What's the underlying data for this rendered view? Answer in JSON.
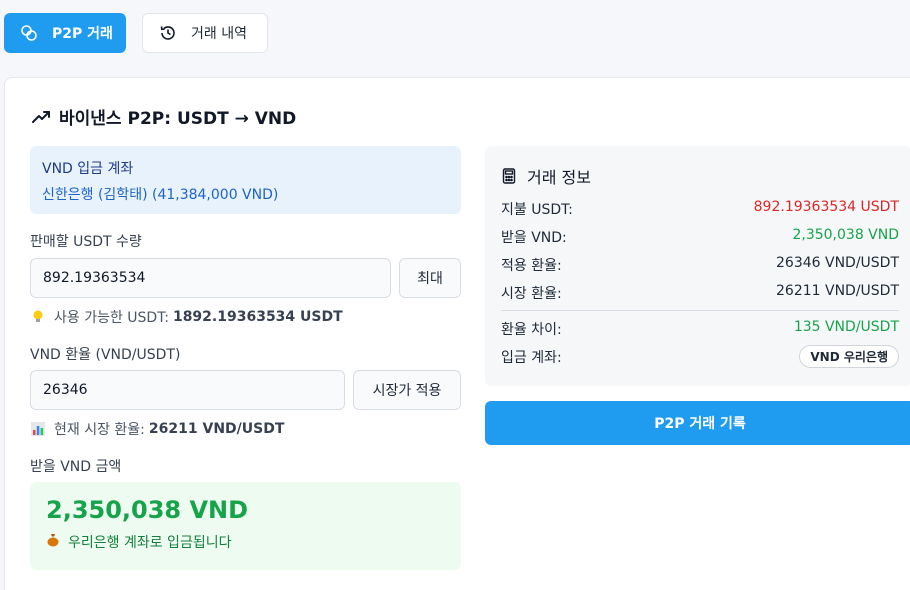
{
  "tabs": {
    "p2p_label": "P2P 거래",
    "history_label": "거래 내역"
  },
  "form": {
    "title": "바이낸스 P2P: USDT → VND",
    "deposit": {
      "label": "VND 입금 계좌",
      "value": "신한은행 (김학태) (41,384,000 VND)"
    },
    "usdt_amount": {
      "label": "판매할 USDT 수량",
      "value": "892.19363534",
      "max_button": "최대",
      "hint_prefix": "사용 가능한 USDT:",
      "hint_value": "1892.19363534 USDT"
    },
    "rate": {
      "label": "VND 환율 (VND/USDT)",
      "value": "26346",
      "market_button": "시장가 적용",
      "hint_prefix": "현재 시장 환율:",
      "hint_value": "26211 VND/USDT"
    },
    "receive": {
      "label": "받을 VND 금액",
      "amount": "2,350,038 VND",
      "note": "우리은행 계좌로 입금됩니다"
    }
  },
  "info": {
    "title": "거래 정보",
    "rows": [
      {
        "label": "지불 USDT:",
        "value": "892.19363534 USDT"
      },
      {
        "label": "받을 VND:",
        "value": "2,350,038 VND"
      },
      {
        "label": "적용 환율:",
        "value": "26346 VND/USDT"
      },
      {
        "label": "시장 환율:",
        "value": "26211 VND/USDT"
      },
      {
        "label": "환율 차이:",
        "value": "135 VND/USDT"
      },
      {
        "label": "입금 계좌:",
        "value": "VND 우리은행"
      }
    ]
  },
  "submit_label": "P2P 거래 기록",
  "colors": {
    "accent": "#1f9cf0",
    "negative": "#dc2626",
    "positive": "#16a34a"
  }
}
